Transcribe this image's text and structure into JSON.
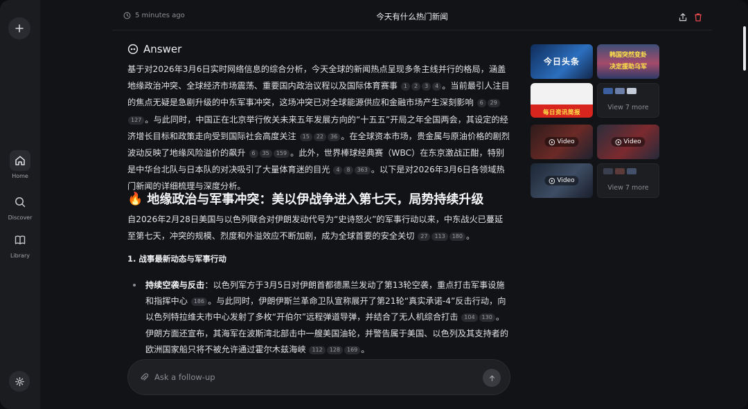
{
  "nav": {
    "home_label": "Home",
    "discover_label": "Discover",
    "library_label": "Library"
  },
  "header": {
    "time": "5 minutes ago",
    "title": "今天有什么热门新闻"
  },
  "answer": {
    "heading": "Answer",
    "intro": [
      {
        "t": "基于对2026年3月6日实时网络信息的综合分析，今天全球的新闻热点呈现多条主线并行的格局，涵盖地缘政治冲突、全球经济市场震荡、重要国内政治议程以及国际体育赛事"
      },
      {
        "c": [
          "1",
          "2",
          "3",
          "4"
        ]
      },
      {
        "t": "。当前最引人注目的焦点无疑是急剧升级的中东军事冲突，这场冲突已对全球能源供应和金融市场产生深刻影响"
      },
      {
        "c": [
          "6",
          "29",
          "127"
        ]
      },
      {
        "t": "。与此同时，中国正在北京举行攸关未来五年发展方向的“十五五”开局之年全国两会，其设定的经济增长目标和政策走向受到国际社会高度关注"
      },
      {
        "c": [
          "15",
          "22",
          "36"
        ]
      },
      {
        "t": "。在全球资本市场，贵金属与原油价格的剧烈波动反映了地缘风险溢价的飙升"
      },
      {
        "c": [
          "6",
          "35",
          "159"
        ]
      },
      {
        "t": "。此外，世界棒球经典赛（WBC）在东京激战正酣，特别是中华台北队与日本队的对决吸引了大量体育迷的目光"
      },
      {
        "c": [
          "4",
          "8",
          "363"
        ]
      },
      {
        "t": "。以下是对2026年3月6日各领域热门新闻的详细梳理与深度分析。"
      }
    ],
    "section_title": "地缘政治与军事冲突：美以伊战争进入第七天，局势持续升级",
    "section_intro": [
      {
        "t": "自2026年2月28日美国与以色列联合对伊朗发动代号为“史诗怒火”的军事行动以来，中东战火已蔓延至第七天，冲突的规模、烈度和外溢效应不断加剧，成为全球首要的安全关切"
      },
      {
        "c": [
          "27",
          "113",
          "180"
        ]
      },
      {
        "t": "。"
      }
    ],
    "subheading": "1. 战事最新动态与军事行动",
    "bullet_lead": "持续空袭与反击",
    "bullet_body": [
      {
        "t": "：以色列军方于3月5日对伊朗首都德黑兰发动了第13轮空袭，重点打击军事设施和指挥中心"
      },
      {
        "c": [
          "186"
        ]
      },
      {
        "t": "。与此同时，伊朗伊斯兰革命卫队宣称展开了第21轮“真实承诺-4”反击行动，向以色列特拉维夫市中心发射了多枚“开伯尔”远程弹道导弹，并结合了无人机综合打击"
      },
      {
        "c": [
          "104",
          "130"
        ]
      },
      {
        "t": "。伊朗方面还宣布，其海军在波斯湾北部击中一艘美国油轮，并警告属于美国、以色列及其支持者的欧洲国家船只将不被允许通过霍尔木兹海峡"
      },
      {
        "c": [
          "112",
          "128",
          "169"
        ]
      },
      {
        "t": "。"
      }
    ]
  },
  "media": {
    "tile1_caption": "今日头条",
    "tile2_caption_line1": "韩国突然变卦",
    "tile2_caption_line2": "决定援助乌军",
    "tile3_caption": "每日资讯简报",
    "view_more_1": "View 7 more",
    "video_label_1": "Video",
    "video_label_2": "Video",
    "video_label_3": "Video",
    "view_more_2": "View 7 more"
  },
  "followup": {
    "placeholder": "Ask a follow-up"
  },
  "colors": {
    "background": "#121316",
    "sidebar": "#1b1c20",
    "delete_red": "#e5484d",
    "citation_bg": "#2a2b30"
  }
}
